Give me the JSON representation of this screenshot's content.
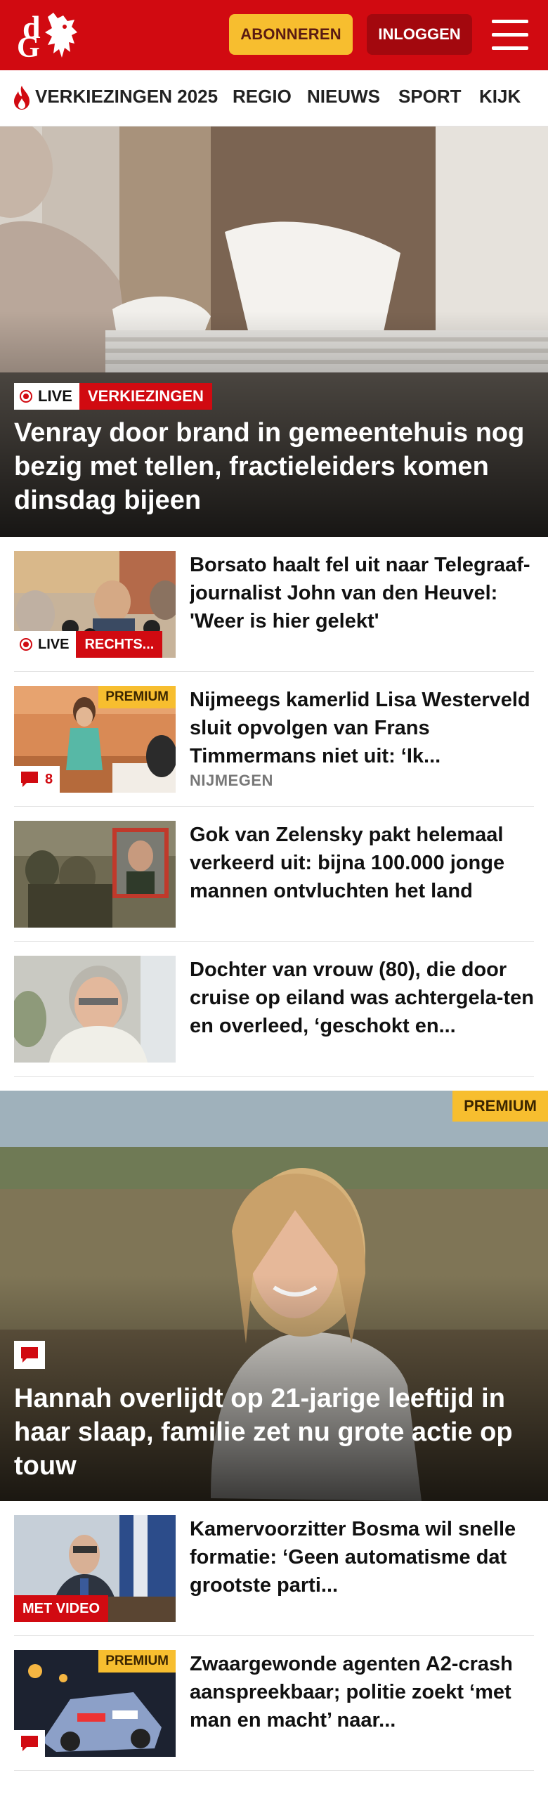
{
  "header": {
    "subscribe_label": "ABONNEREN",
    "login_label": "INLOGGEN",
    "brand_color": "#d10a11",
    "accent_color": "#f7be2f"
  },
  "nav": {
    "items": [
      "VERKIEZINGEN 2025",
      "REGIO",
      "NIEUWS",
      "SPORT",
      "KIJK"
    ]
  },
  "hero": {
    "live_label": "LIVE",
    "tag": "VERKIEZINGEN",
    "title": "Venray door brand in gemeentehuis nog bezig met tellen, fractieleiders komen dinsdag bijeen"
  },
  "articles": [
    {
      "title": "Borsato haalt fel uit naar Telegraaf-journalist John van den Heuvel: 'Weer is hier gelekt'",
      "live_label": "LIVE",
      "tag": "RECHTS..."
    },
    {
      "title": "Nijmeegs kamerlid Lisa Westerveld sluit opvolgen van Frans Timmermans niet uit: ‘Ik...",
      "premium": "PREMIUM",
      "comments": "8",
      "label": "NIJMEGEN"
    },
    {
      "title": "Gok van Zelensky pakt helemaal verkeerd uit: bijna 100.000 jonge mannen ontvluchten het land"
    },
    {
      "title": "Dochter van vrouw (80), die door cruise op eiland was achtergela-ten en overleed, ‘geschokt en..."
    }
  ],
  "feature": {
    "premium": "PREMIUM",
    "title": "Hannah overlijdt op 21-jarige leeftijd in haar slaap, familie zet nu grote actie op touw"
  },
  "articles2": [
    {
      "title": "Kamervoorzitter Bosma wil snelle formatie: ‘Geen automatisme dat grootste parti...",
      "video": "MET VIDEO"
    },
    {
      "title": "Zwaargewonde agenten A2-crash aanspreekbaar; politie zoekt ‘met man en macht’ naar...",
      "premium": "PREMIUM"
    }
  ]
}
